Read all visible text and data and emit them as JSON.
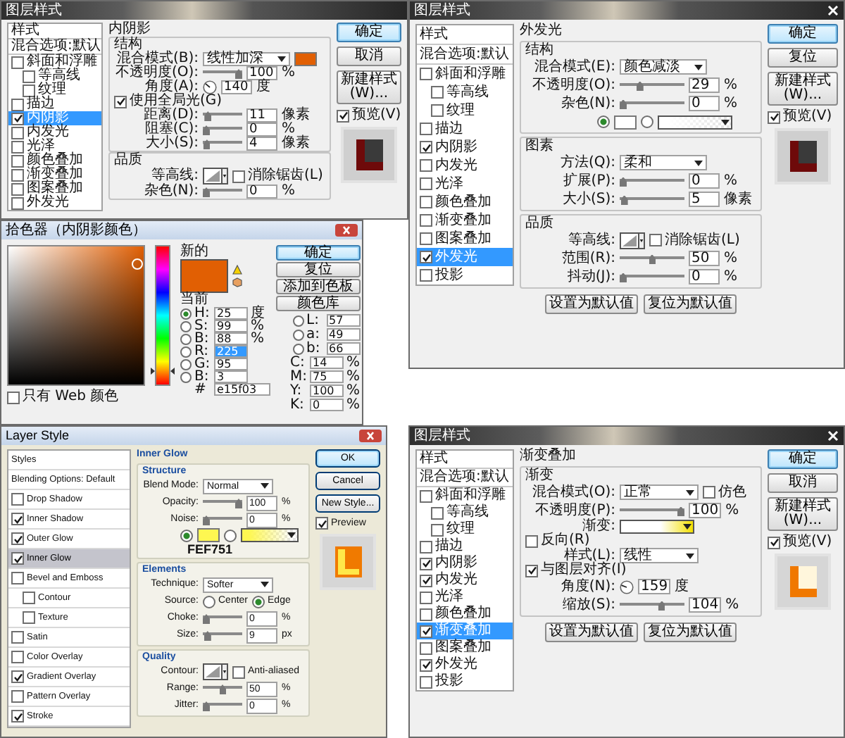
{
  "windows": [
    {
      "kind": "layer_style",
      "title": "图层样式",
      "sidebar": [
        {
          "label": "样式",
          "kind": "header",
          "selected": false
        },
        {
          "label": "混合选项:默认",
          "kind": "header",
          "selected": false
        },
        {
          "label": "斜面和浮雕",
          "kind": "check",
          "checked": false,
          "selected": false,
          "children": [
            {
              "label": "等高线",
              "kind": "check",
              "checked": false,
              "selected": false
            },
            {
              "label": "纹理",
              "kind": "check",
              "checked": false,
              "selected": false
            }
          ]
        },
        {
          "label": "描边",
          "kind": "check",
          "checked": false,
          "selected": false
        },
        {
          "label": "内阴影",
          "kind": "check",
          "checked": true,
          "selected": true
        },
        {
          "label": "内发光",
          "kind": "check",
          "checked": false,
          "selected": false
        },
        {
          "label": "光泽",
          "kind": "check",
          "checked": false,
          "selected": false
        },
        {
          "label": "颜色叠加",
          "kind": "check",
          "checked": false,
          "selected": false
        },
        {
          "label": "渐变叠加",
          "kind": "check",
          "checked": false,
          "selected": false
        },
        {
          "label": "图案叠加",
          "kind": "check",
          "checked": false,
          "selected": false
        },
        {
          "label": "外发光",
          "kind": "check",
          "checked": false,
          "selected": false
        }
      ],
      "panel": {
        "title": "内阴影",
        "groups": [
          {
            "title": "结构",
            "rows": [
              {
                "kind": "select",
                "label": "混合模式(B):",
                "value": "线性加深",
                "swatch": {
                  "color": "#e15f03"
                }
              },
              {
                "kind": "slider",
                "label": "不透明度(O):",
                "level": 1,
                "value": "100",
                "unit": "%"
              },
              {
                "kind": "angle",
                "label": "角度(A):",
                "value": "140",
                "unit": "度",
                "checkbox": {
                  "label": "使用全局光(G)",
                  "checked": true
                }
              },
              {
                "kind": "slider",
                "label": "距离(D):",
                "level": 0.05,
                "value": "11",
                "unit": "像素"
              },
              {
                "kind": "slider",
                "label": "阻塞(C):",
                "level": 0,
                "value": "0",
                "unit": "%"
              },
              {
                "kind": "slider",
                "label": "大小(S):",
                "level": 0.02,
                "value": "4",
                "unit": "像素"
              }
            ]
          },
          {
            "title": "品质",
            "rows": [
              {
                "kind": "contour",
                "label": "等高线:",
                "checkbox": {
                  "label": "消除锯齿(L)",
                  "checked": false
                }
              },
              {
                "kind": "slider",
                "label": "杂色(N):",
                "level": 0,
                "value": "0",
                "unit": "%"
              }
            ]
          }
        ]
      },
      "buttons": [
        {
          "label": "确定",
          "default": true
        },
        {
          "label": "取消",
          "default": false
        },
        {
          "label": "新建样式(W)...",
          "default": false
        }
      ],
      "preview": {
        "label": "预览(V)",
        "checked": true,
        "thumbnail": {
          "kind": "inner_shadow"
        }
      }
    },
    {
      "kind": "layer_style",
      "title": "图层样式",
      "sidebar": [
        {
          "label": "样式",
          "kind": "header",
          "selected": false
        },
        {
          "label": "混合选项:默认",
          "kind": "header",
          "selected": false
        },
        {
          "label": "斜面和浮雕",
          "kind": "check",
          "checked": false,
          "selected": false,
          "children": [
            {
              "label": "等高线",
              "kind": "check",
              "checked": false,
              "selected": false
            },
            {
              "label": "纹理",
              "kind": "check",
              "checked": false,
              "selected": false
            }
          ]
        },
        {
          "label": "描边",
          "kind": "check",
          "checked": false,
          "selected": false
        },
        {
          "label": "内阴影",
          "kind": "check",
          "checked": true,
          "selected": false
        },
        {
          "label": "内发光",
          "kind": "check",
          "checked": false,
          "selected": false
        },
        {
          "label": "光泽",
          "kind": "check",
          "checked": false,
          "selected": false
        },
        {
          "label": "颜色叠加",
          "kind": "check",
          "checked": false,
          "selected": false
        },
        {
          "label": "渐变叠加",
          "kind": "check",
          "checked": false,
          "selected": false
        },
        {
          "label": "图案叠加",
          "kind": "check",
          "checked": false,
          "selected": false
        },
        {
          "label": "外发光",
          "kind": "check",
          "checked": true,
          "selected": true
        },
        {
          "label": "投影",
          "kind": "check",
          "checked": false,
          "selected": false
        }
      ],
      "panel": {
        "title": "外发光",
        "groups": [
          {
            "title": "结构",
            "rows": [
              {
                "kind": "select",
                "label": "混合模式(E):",
                "value": "颜色减淡"
              },
              {
                "kind": "slider",
                "label": "不透明度(O):",
                "level": 0.29,
                "value": "29",
                "unit": "%"
              },
              {
                "kind": "slider",
                "label": "杂色(N):",
                "level": 0,
                "value": "0",
                "unit": "%"
              },
              {
                "kind": "colors",
                "options": [
                  {
                    "kind": "solid",
                    "selected": true,
                    "color": "#ffffff"
                  },
                  {
                    "kind": "gradient",
                    "selected": false
                  }
                ]
              }
            ]
          },
          {
            "title": "图素",
            "rows": [
              {
                "kind": "select",
                "label": "方法(Q):",
                "value": "柔和"
              },
              {
                "kind": "slider",
                "label": "扩展(P):",
                "level": 0,
                "value": "0",
                "unit": "%"
              },
              {
                "kind": "slider",
                "label": "大小(S):",
                "level": 0.02,
                "value": "5",
                "unit": "像素"
              }
            ]
          },
          {
            "title": "品质",
            "rows": [
              {
                "kind": "contour",
                "label": "等高线:",
                "checkbox": {
                  "label": "消除锯齿(L)",
                  "checked": false
                }
              },
              {
                "kind": "slider",
                "label": "范围(R):",
                "level": 0.5,
                "value": "50",
                "unit": "%"
              },
              {
                "kind": "slider",
                "label": "抖动(J):",
                "level": 0,
                "value": "0",
                "unit": "%"
              }
            ]
          }
        ],
        "footer_buttons": [
          "设置为默认值",
          "复位为默认值"
        ]
      },
      "buttons": [
        {
          "label": "确定",
          "default": true
        },
        {
          "label": "复位",
          "default": false
        },
        {
          "label": "新建样式(W)...",
          "default": false
        }
      ],
      "preview": {
        "label": "预览(V)",
        "checked": true,
        "thumbnail": {
          "kind": "inner_shadow"
        }
      }
    },
    {
      "kind": "color_picker",
      "title": "拾色器（内阴影颜色）",
      "swatches": [
        {
          "label": "新的",
          "color": "#e15f03"
        },
        {
          "label": "当前",
          "color": "#e15f03"
        }
      ],
      "hue_bar": {
        "level": 0.07
      },
      "buttons": [
        {
          "label": "确定",
          "default": true
        },
        {
          "label": "复位",
          "default": false
        },
        {
          "label": "添加到色板",
          "default": false
        },
        {
          "label": "颜色库",
          "default": false
        }
      ],
      "hsb_rgb": [
        {
          "label": "H:",
          "value": "25",
          "unit": "度",
          "selected": true,
          "highlighted": false
        },
        {
          "label": "S:",
          "value": "99",
          "unit": "%",
          "selected": false,
          "highlighted": false
        },
        {
          "label": "B:",
          "value": "88",
          "unit": "%",
          "selected": false,
          "highlighted": false
        },
        {
          "label": "R:",
          "value": "225",
          "selected": false,
          "highlighted": true
        },
        {
          "label": "G:",
          "value": "95",
          "selected": false,
          "highlighted": false
        },
        {
          "label": "B:",
          "value": "3",
          "selected": false,
          "highlighted": false
        }
      ],
      "lab": [
        {
          "label": "L:",
          "value": "57",
          "selected": false
        },
        {
          "label": "a:",
          "value": "49",
          "selected": false
        },
        {
          "label": "b:",
          "value": "66",
          "selected": false
        }
      ],
      "cmyk": [
        {
          "label": "C:",
          "value": "14",
          "unit": "%"
        },
        {
          "label": "M:",
          "value": "75",
          "unit": "%"
        },
        {
          "label": "Y:",
          "value": "100",
          "unit": "%"
        },
        {
          "label": "K:",
          "value": "0",
          "unit": "%"
        }
      ],
      "web_only": {
        "label": "只有 Web 颜色",
        "checked": false
      },
      "hex": {
        "label": "#",
        "value": "e15f03"
      }
    },
    {
      "kind": "layer_style_classic",
      "title": "Layer Style",
      "sidebar": [
        {
          "label": "Styles",
          "kind": "header",
          "selected": false
        },
        {
          "label": "Blending Options: Default",
          "kind": "header",
          "selected": false
        },
        {
          "label": "Drop Shadow",
          "kind": "check",
          "checked": false,
          "selected": false
        },
        {
          "label": "Inner Shadow",
          "kind": "check",
          "checked": true,
          "selected": false
        },
        {
          "label": "Outer Glow",
          "kind": "check",
          "checked": true,
          "selected": false
        },
        {
          "label": "Inner Glow",
          "kind": "check",
          "checked": true,
          "selected": true
        },
        {
          "label": "Bevel and Emboss",
          "kind": "check",
          "checked": false,
          "selected": false,
          "children": [
            {
              "label": "Contour",
              "kind": "check",
              "checked": false,
              "selected": false
            },
            {
              "label": "Texture",
              "kind": "check",
              "checked": false,
              "selected": false
            }
          ]
        },
        {
          "label": "Satin",
          "kind": "check",
          "checked": false,
          "selected": false
        },
        {
          "label": "Color Overlay",
          "kind": "check",
          "checked": false,
          "selected": false
        },
        {
          "label": "Gradient Overlay",
          "kind": "check",
          "checked": true,
          "selected": false
        },
        {
          "label": "Pattern Overlay",
          "kind": "check",
          "checked": false,
          "selected": false
        },
        {
          "label": "Stroke",
          "kind": "check",
          "checked": true,
          "selected": false
        }
      ],
      "panel": {
        "title": "Inner Glow",
        "groups": [
          {
            "title": "Structure",
            "rows": [
              {
                "kind": "select",
                "label": "Blend Mode:",
                "value": "Normal"
              },
              {
                "kind": "slider",
                "label": "Opacity:",
                "level": 1,
                "value": "100",
                "unit": "%"
              },
              {
                "kind": "slider",
                "label": "Noise:",
                "level": 0,
                "value": "0",
                "unit": "%"
              },
              {
                "kind": "colors",
                "options": [
                  {
                    "kind": "solid",
                    "selected": true,
                    "color": "#fef751"
                  },
                  {
                    "kind": "gradient",
                    "selected": false
                  }
                ],
                "note": "FEF751"
              }
            ]
          },
          {
            "title": "Elements",
            "rows": [
              {
                "kind": "select",
                "label": "Technique:",
                "value": "Softer"
              },
              {
                "kind": "radios",
                "label": "Source:",
                "options": [
                  {
                    "label": "Center",
                    "selected": false
                  },
                  {
                    "label": "Edge",
                    "selected": true
                  }
                ]
              },
              {
                "kind": "slider",
                "label": "Choke:",
                "level": 0,
                "value": "0",
                "unit": "%"
              },
              {
                "kind": "slider",
                "label": "Size:",
                "level": 0.04,
                "value": "9",
                "unit": "px"
              }
            ]
          },
          {
            "title": "Quality",
            "rows": [
              {
                "kind": "contour",
                "label": "Contour:",
                "checkbox": {
                  "label": "Anti-aliased",
                  "checked": false
                }
              },
              {
                "kind": "slider",
                "label": "Range:",
                "level": 0.5,
                "value": "50",
                "unit": "%"
              },
              {
                "kind": "slider",
                "label": "Jitter:",
                "level": 0,
                "value": "0",
                "unit": "%"
              }
            ]
          }
        ]
      },
      "buttons": [
        {
          "label": "OK",
          "default": true
        },
        {
          "label": "Cancel",
          "default": false
        },
        {
          "label": "New Style...",
          "default": false
        }
      ],
      "preview": {
        "label": "Preview",
        "checked": true,
        "thumbnail": {
          "kind": "inner_glow"
        }
      }
    },
    {
      "kind": "layer_style",
      "title": "图层样式",
      "sidebar": [
        {
          "label": "样式",
          "kind": "header",
          "selected": false
        },
        {
          "label": "混合选项:默认",
          "kind": "header",
          "selected": false
        },
        {
          "label": "斜面和浮雕",
          "kind": "check",
          "checked": false,
          "selected": false,
          "children": [
            {
              "label": "等高线",
              "kind": "check",
              "checked": false,
              "selected": false
            },
            {
              "label": "纹理",
              "kind": "check",
              "checked": false,
              "selected": false
            }
          ]
        },
        {
          "label": "描边",
          "kind": "check",
          "checked": false,
          "selected": false
        },
        {
          "label": "内阴影",
          "kind": "check",
          "checked": true,
          "selected": false
        },
        {
          "label": "内发光",
          "kind": "check",
          "checked": true,
          "selected": false
        },
        {
          "label": "光泽",
          "kind": "check",
          "checked": false,
          "selected": false
        },
        {
          "label": "颜色叠加",
          "kind": "check",
          "checked": false,
          "selected": false
        },
        {
          "label": "渐变叠加",
          "kind": "check",
          "checked": true,
          "selected": true
        },
        {
          "label": "图案叠加",
          "kind": "check",
          "checked": false,
          "selected": false
        },
        {
          "label": "外发光",
          "kind": "check",
          "checked": true,
          "selected": false
        },
        {
          "label": "投影",
          "kind": "check",
          "checked": false,
          "selected": false
        }
      ],
      "panel": {
        "title": "渐变叠加",
        "groups": [
          {
            "title": "渐变",
            "rows": [
              {
                "kind": "select",
                "label": "混合模式(O):",
                "value": "正常",
                "checkbox": {
                  "label": "仿色",
                  "checked": false
                }
              },
              {
                "kind": "slider",
                "label": "不透明度(P):",
                "level": 1,
                "value": "100",
                "unit": "%"
              },
              {
                "kind": "gradient",
                "label": "渐变:",
                "checkbox": {
                  "label": "反向(R)",
                  "checked": false
                }
              },
              {
                "kind": "select",
                "label": "样式(L):",
                "value": "线性",
                "checkbox": {
                  "label": "与图层对齐(I)",
                  "checked": true
                }
              },
              {
                "kind": "angle",
                "label": "角度(N):",
                "value": "159",
                "unit": "度"
              },
              {
                "kind": "slider",
                "label": "缩放(S):",
                "level": 0.67,
                "value": "104",
                "unit": "%"
              }
            ]
          }
        ],
        "footer_buttons": [
          "设置为默认值",
          "复位为默认值"
        ]
      },
      "buttons": [
        {
          "label": "确定",
          "default": true
        },
        {
          "label": "取消",
          "default": false
        },
        {
          "label": "新建样式(W)...",
          "default": false
        }
      ],
      "preview": {
        "label": "预览(V)",
        "checked": true,
        "thumbnail": {
          "kind": "gradient"
        }
      }
    }
  ]
}
